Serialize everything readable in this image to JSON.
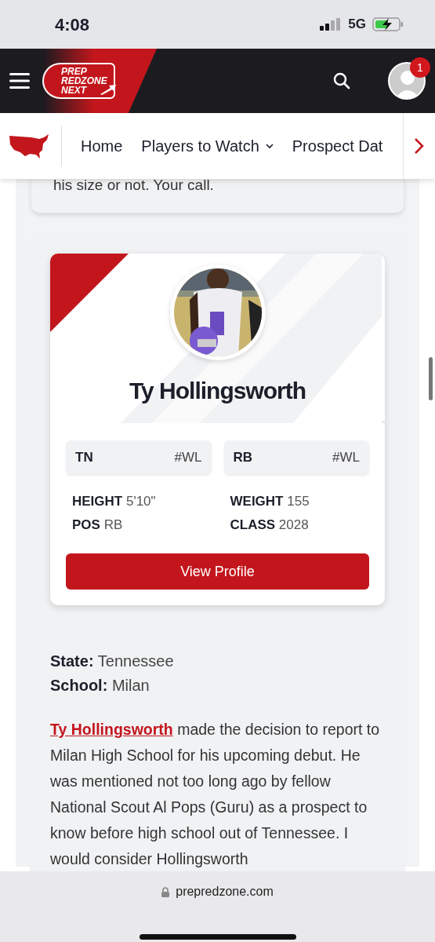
{
  "status_bar": {
    "time": "4:08",
    "network": "5G"
  },
  "header": {
    "logo_lines": [
      "PREP",
      "REDZONE",
      "NEXT"
    ],
    "notification_count": "1"
  },
  "nav": {
    "items": [
      {
        "label": "Home",
        "has_menu": false
      },
      {
        "label": "Players to Watch",
        "has_menu": true
      },
      {
        "label": "Prospect Dat",
        "has_menu": false
      }
    ]
  },
  "previous_text": "his size or not. Your call.",
  "player": {
    "name": "Ty Hollingsworth",
    "chips": [
      {
        "label": "TN",
        "rank": "#WL"
      },
      {
        "label": "RB",
        "rank": "#WL"
      }
    ],
    "stats": [
      {
        "label": "HEIGHT",
        "value": "5'10\""
      },
      {
        "label": "WEIGHT",
        "value": "155"
      },
      {
        "label": "POS",
        "value": "RB"
      },
      {
        "label": "CLASS",
        "value": "2028"
      }
    ],
    "button": "View Profile"
  },
  "facts": [
    {
      "label": "State:",
      "value": "Tennessee"
    },
    {
      "label": "School:",
      "value": "Milan"
    }
  ],
  "article": {
    "link": "Ty Hollingsworth",
    "text": "made the decision to report to Milan High School for his upcoming debut. He was mentioned not too long ago by fellow National Scout Al Pops (Guru) as a prospect to know before high school out of Tennessee. I would consider Hollingsworth"
  },
  "browser": {
    "url": "prepredzone.com"
  }
}
